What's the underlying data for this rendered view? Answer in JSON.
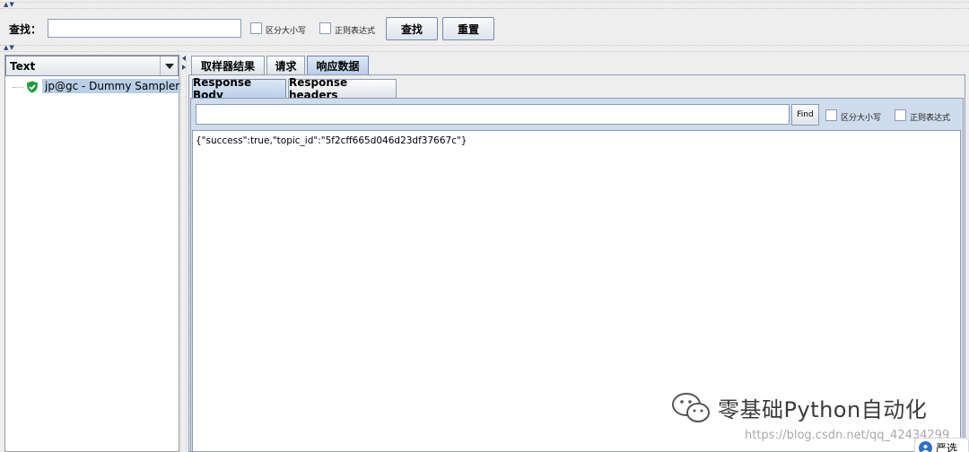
{
  "search": {
    "label": "查找：",
    "value": "",
    "case_sensitive_label": "区分大小写",
    "regex_label": "正则表达式",
    "find_button": "查找",
    "reset_button": "重置"
  },
  "left_panel": {
    "renderer_selected": "Text",
    "tree_items": [
      {
        "label": "jp@gc - Dummy Sampler",
        "status": "success"
      }
    ]
  },
  "main_tabs": [
    {
      "label": "取样器结果",
      "active": false
    },
    {
      "label": "请求",
      "active": false
    },
    {
      "label": "响应数据",
      "active": true
    }
  ],
  "sub_tabs": [
    {
      "label": "Response Body",
      "active": true
    },
    {
      "label": "Response headers",
      "active": false
    }
  ],
  "response_search": {
    "value": "",
    "find_button": "Find",
    "case_sensitive_label": "区分大小写",
    "regex_label": "正则表达式"
  },
  "response_body": "{\"success\":true,\"topic_id\":\"5f2cff665d046d23df37667c\"}",
  "overlay": {
    "watermark": "零基础Python自动化",
    "url": "https://blog.csdn.net/qq_42434299",
    "corner_label": "严选"
  },
  "colors": {
    "selection": "#b8cfe5",
    "success_icon": "#1f9a3c",
    "active_tab": "#b9cfe8"
  }
}
